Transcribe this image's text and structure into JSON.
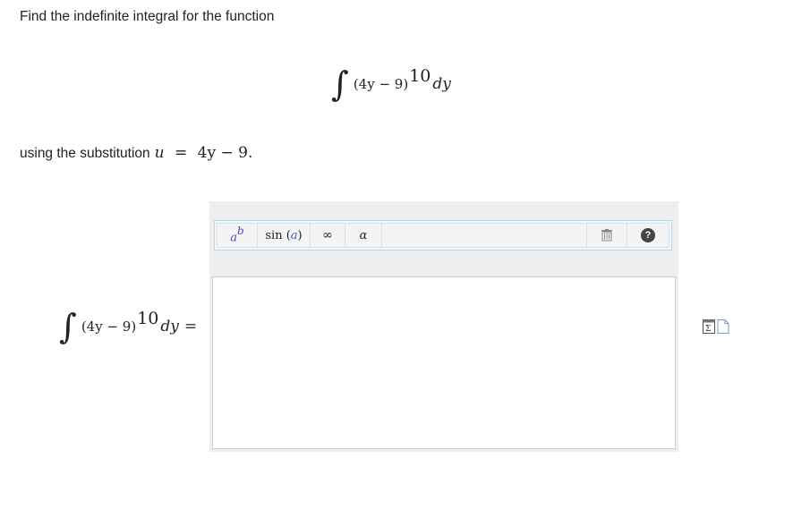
{
  "prompt": "Find the indefinite integral for the function",
  "integral": {
    "sign": "∫",
    "base": "(4y − 9)",
    "exponent": "10",
    "differential": "dy"
  },
  "substitution": {
    "text": "using the substitution",
    "variable": "u",
    "equals": "=",
    "expression": "4y − 9",
    "period": "."
  },
  "toolbar": {
    "superscript": {
      "base": "a",
      "sup": "b",
      "icon": "superscript-icon"
    },
    "trig": {
      "fn": "sin",
      "open": "(",
      "arg": "a",
      "close": ")"
    },
    "infinity": "∞",
    "greek": "α",
    "clear_icon": "trash-icon",
    "help": "?"
  },
  "answer_row": {
    "equals": "="
  },
  "side_icons": [
    "formula-editor-icon",
    "document-icon"
  ],
  "colors": {
    "editor_frame": "#eeeeee",
    "toolbar_border": "#b9d7ea",
    "superscript_color": "#5a3fbf"
  }
}
